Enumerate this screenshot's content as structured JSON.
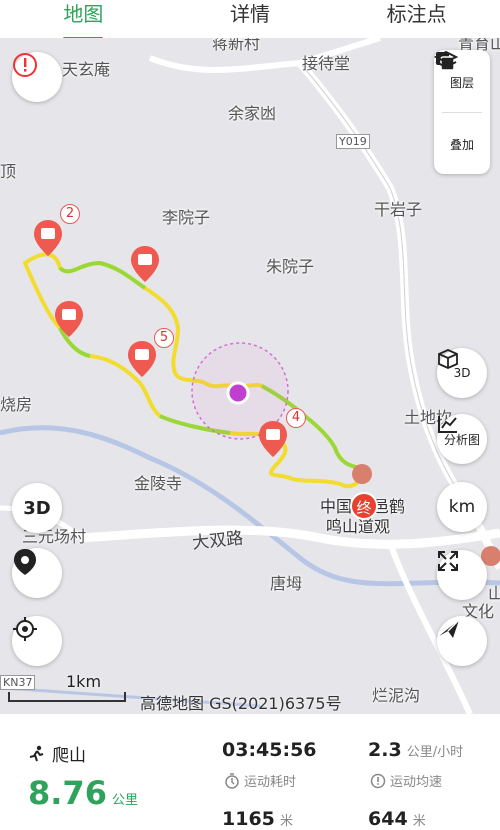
{
  "tabs": [
    "地图",
    "详情",
    "标注点"
  ],
  "map": {
    "places": {
      "tianxuanan": "天玄庵",
      "jiedaitang": "接待堂",
      "yujiadang": "余家凼",
      "ding": "顶",
      "liyuanzi": "李院子",
      "ganyanzi": "干岩子",
      "zhuyuanzi": "朱院子",
      "shaofang": "烧房",
      "tudikan": "土地坎",
      "jinlingsi": "金陵寺",
      "guan_line1": "中国",
      "guan_line1b": "邑鹤",
      "guan_line2": "鸣山道观",
      "sanyuanchang": "三元场村",
      "tangwan": "唐坶",
      "wenhua1": "山",
      "wenhua2": "文化",
      "lannigou": "烂泥沟",
      "topcut1": "蒋新村",
      "topcut2": "青育山",
      "road_top": "Y019",
      "road_bottom": "KN37",
      "dashuanglu": "大双路"
    },
    "markers": {
      "badge2": "2",
      "badge4": "4",
      "badge5": "5",
      "end": "终"
    },
    "buttons": {
      "layers": "图层",
      "overlay": "叠加",
      "three_d": "3D",
      "analysis": "分析图",
      "km": "km"
    },
    "scale": "1km",
    "copyright": "高德地图 GS(2021)6375号"
  },
  "stats": {
    "sport": "爬山",
    "distance": "8.76",
    "distance_unit": "公里",
    "duration": "03:45:56",
    "duration_label": "运动耗时",
    "speed": "2.3",
    "speed_unit": "公里/小时",
    "speed_label": "运动均速",
    "ascent": "1165",
    "ascent_unit": "米",
    "altitude": "644",
    "altitude_unit": "米"
  },
  "colors": {
    "accent": "#2fa25b",
    "track_yellow": "#f2dc2e",
    "track_green": "#9ad83a",
    "marker_red": "#ee5a4f"
  }
}
